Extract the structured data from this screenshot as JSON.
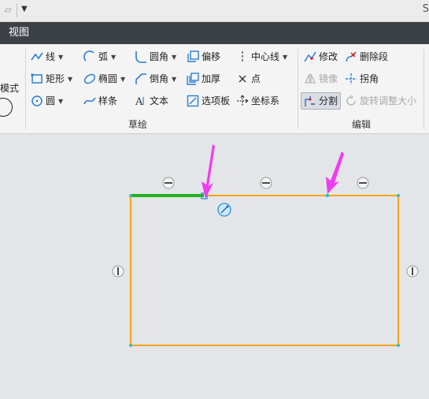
{
  "app": {
    "title_fragment": "S"
  },
  "tabs": {
    "active": "视图"
  },
  "ribbon": {
    "mode": {
      "label": "模式"
    },
    "sketch": {
      "group_label": "草绘",
      "col1": [
        {
          "label": "线",
          "icon": "line-icon"
        },
        {
          "label": "矩形",
          "icon": "rectangle-icon"
        },
        {
          "label": "圆",
          "icon": "circle-icon"
        }
      ],
      "col2": [
        {
          "label": "弧",
          "icon": "arc-icon"
        },
        {
          "label": "椭圆",
          "icon": "ellipse-icon"
        },
        {
          "label": "样条",
          "icon": "spline-icon"
        }
      ],
      "col3": [
        {
          "label": "圆角",
          "icon": "fillet-icon"
        },
        {
          "label": "倒角",
          "icon": "chamfer-icon"
        },
        {
          "label": "文本",
          "icon": "text-icon"
        }
      ],
      "col4": [
        {
          "label": "偏移",
          "icon": "offset-icon"
        },
        {
          "label": "加厚",
          "icon": "thicken-icon"
        },
        {
          "label": "选项板",
          "icon": "palette-icon"
        }
      ],
      "col5": [
        {
          "label": "中心线",
          "icon": "centerline-icon"
        },
        {
          "label": "点",
          "icon": "point-icon"
        },
        {
          "label": "坐标系",
          "icon": "coordinate-system-icon"
        }
      ]
    },
    "edit": {
      "group_label": "编辑",
      "items": {
        "modify": "修改",
        "delete_segment": "删除段",
        "mirror": "镜像",
        "corner": "拐角",
        "divide": "分割",
        "rotate_resize": "旋转调整大小"
      }
    }
  },
  "colors": {
    "rectangle": "#f5a31a",
    "selected_segment": "#22b21f",
    "arrow": "#f03cf0",
    "vertex": "#25c4c4",
    "marker": "#2b8fd8"
  }
}
